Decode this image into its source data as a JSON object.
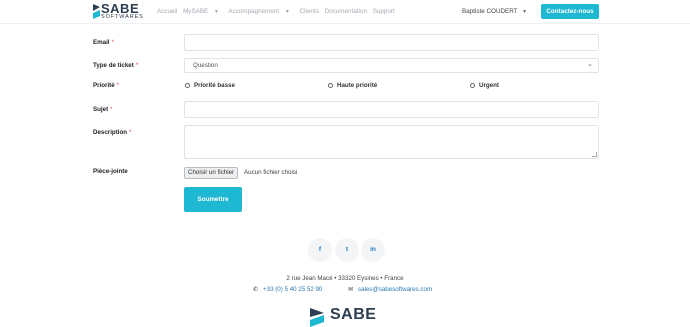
{
  "header": {
    "logo_text": "SABE",
    "logo_sub": "SOFTWARES",
    "nav": [
      {
        "label": "Accueil"
      },
      {
        "label": "MySABE",
        "dropdown": true
      },
      {
        "label": "Accompagnement",
        "dropdown": true
      },
      {
        "label": "Clients"
      },
      {
        "label": "Documentation"
      },
      {
        "label": "Support"
      }
    ],
    "user_name": "Baptiste COUDERT",
    "cta_label": "Contactez-nous"
  },
  "form": {
    "email_label": "Email",
    "type_label": "Type de ticket",
    "type_value": "Question",
    "priority_label": "Priorité",
    "priority_options": [
      "Priorité basse",
      "Haute priorité",
      "Urgent"
    ],
    "subject_label": "Sujet",
    "description_label": "Description",
    "attachment_label": "Pièce-jointe",
    "file_button": "Choisir un fichier",
    "file_none": "Aucun fichier choisi",
    "submit_label": "Soumettre",
    "required_mark": "*"
  },
  "footer": {
    "social": [
      "f",
      "t",
      "in"
    ],
    "address": "2 rue Jean Macé • 33320 Eysines • France",
    "phone": "+33 (0) 5 40 25 52 90",
    "email": "sales@sabesoftwares.com",
    "logo_text": "SABE"
  },
  "colors": {
    "accent": "#1fb8d3",
    "brand_dark": "#2c3e50",
    "link": "#2a7ab0",
    "required": "#e0453a"
  }
}
